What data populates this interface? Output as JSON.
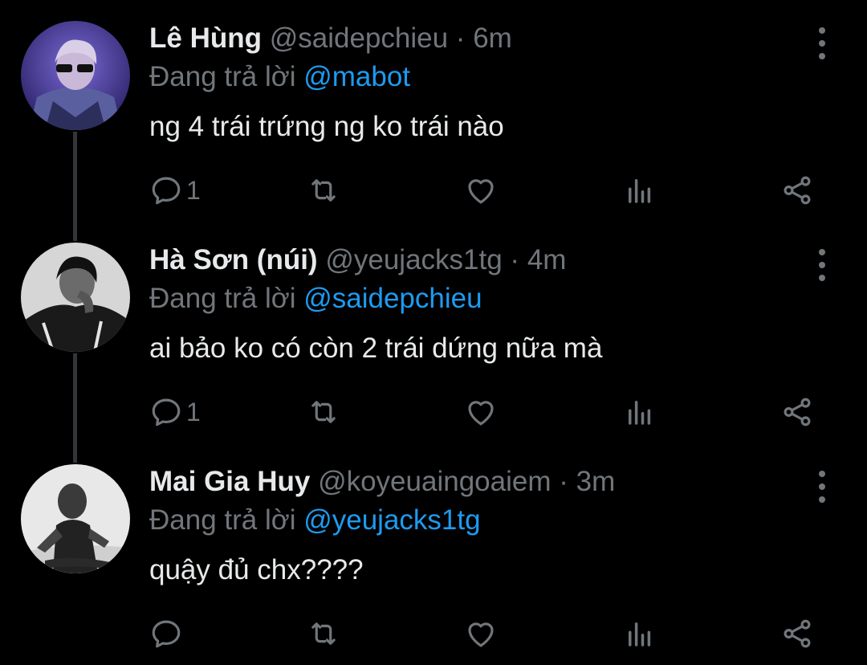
{
  "colors": {
    "background": "#000000",
    "text": "#e7e9ea",
    "muted": "#71767b",
    "mention": "#1d9bf0",
    "thread_line": "#333639"
  },
  "tweets": [
    {
      "name": "Lê Hùng",
      "handle": "@saidepchieu",
      "separator": "·",
      "time": "6m",
      "replying_prefix": "Đang trả lời",
      "replying_to": "@mabot",
      "text": "ng 4 trái trứng ng ko trái nào",
      "reply_count": "1",
      "icons": [
        "reply-icon",
        "retweet-icon",
        "like-icon",
        "views-icon",
        "share-icon",
        "more-icon"
      ]
    },
    {
      "name": "Hà Sơn (núi)",
      "handle": "@yeujacks1tg",
      "separator": "·",
      "time": "4m",
      "replying_prefix": "Đang trả lời",
      "replying_to": "@saidepchieu",
      "text": "ai bảo ko có còn 2 trái dứng nữa mà",
      "reply_count": "1",
      "icons": [
        "reply-icon",
        "retweet-icon",
        "like-icon",
        "views-icon",
        "share-icon",
        "more-icon"
      ]
    },
    {
      "name": "Mai Gia Huy",
      "handle": "@koyeuaingoaiem",
      "separator": "·",
      "time": "3m",
      "replying_prefix": "Đang trả lời",
      "replying_to": "@yeujacks1tg",
      "text": "quậy đủ chx????",
      "reply_count": "",
      "icons": [
        "reply-icon",
        "retweet-icon",
        "like-icon",
        "views-icon",
        "share-icon",
        "more-icon"
      ]
    }
  ]
}
